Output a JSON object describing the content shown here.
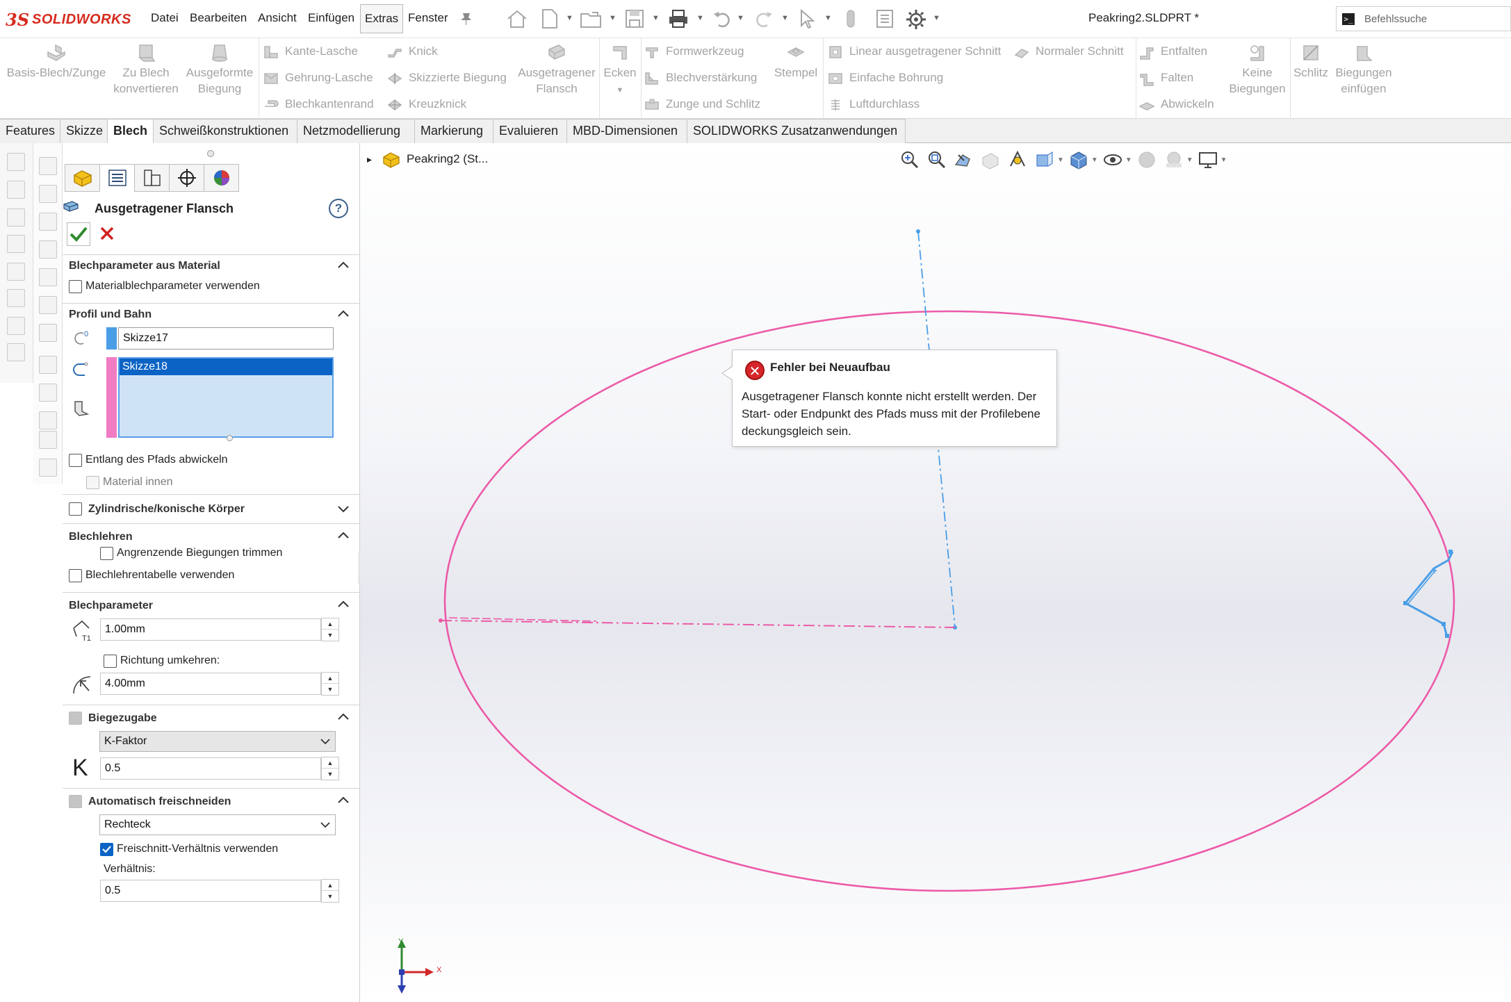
{
  "app": {
    "logo_ds": "3S",
    "logo_text": "SOLIDWORKS",
    "document_title": "Peakring2.SLDPRT *",
    "brand_color": "#d52b1e"
  },
  "menu": {
    "items": [
      "Datei",
      "Bearbeiten",
      "Ansicht",
      "Einfügen",
      "Extras",
      "Fenster"
    ],
    "active": "Extras"
  },
  "search": {
    "placeholder": "Befehlssuche",
    "icon": "terminal-icon"
  },
  "ribbon": {
    "basis_blech": "Basis-Blech/Zunge",
    "zu_blech_1": "Zu Blech",
    "zu_blech_2": "konvertieren",
    "ausgeformte_1": "Ausgeformte",
    "ausgeformte_2": "Biegung",
    "kante_lasche": "Kante-Lasche",
    "gehrung_lasche": "Gehrung-Lasche",
    "blechkantenrand": "Blechkantenrand",
    "knick": "Knick",
    "skizzierte_biegung": "Skizzierte Biegung",
    "kreuzknick": "Kreuzknick",
    "ausgetragener_1": "Ausgetragener",
    "ausgetragener_2": "Flansch",
    "ecken": "Ecken",
    "formwerkzeug": "Formwerkzeug",
    "blechverstaerkung": "Blechverstärkung",
    "zunge_schlitz": "Zunge und Schlitz",
    "stempel": "Stempel",
    "linear_schnitt": "Linear ausgetragener Schnitt",
    "normaler_schnitt": "Normaler Schnitt",
    "einfache_bohrung": "Einfache Bohrung",
    "luftdurchlass": "Luftdurchlass",
    "entfalten": "Entfalten",
    "falten": "Falten",
    "abwickeln": "Abwickeln",
    "keine_1": "Keine",
    "keine_2": "Biegungen",
    "schlitz": "Schlitz",
    "biegungen_1": "Biegungen",
    "biegungen_2": "einfügen"
  },
  "tabs": [
    "Features",
    "Skizze",
    "Blech",
    "Schweißkonstruktionen",
    "Netzmodellierung",
    "Markierung",
    "Evaluieren",
    "MBD-Dimensionen",
    "SOLIDWORKS Zusatzanwendungen"
  ],
  "active_tab": "Blech",
  "pm": {
    "title": "Ausgetragener Flansch",
    "help": "?",
    "sections": {
      "material": {
        "title": "Blechparameter aus Material",
        "cb_label": "Materialblechparameter verwenden",
        "checked": false
      },
      "profil": {
        "title": "Profil und Bahn",
        "profile_value": "Skizze17",
        "path_value": "Skizze18",
        "profile_color": "#4a9ee6",
        "path_color": "#f17cc4",
        "cb_abwickeln": "Entlang des Pfads abwickeln",
        "cb_material_innen": "Material innen"
      },
      "zylinder": {
        "title": "Zylindrische/konische Körper"
      },
      "blechlehren": {
        "title": "Blechlehren",
        "cb_trim": "Angrenzende Biegungen trimmen",
        "cb_tabelle": "Blechlehrentabelle verwenden"
      },
      "blechparameter": {
        "title": "Blechparameter",
        "thickness": "1.00mm",
        "cb_richtung": "Richtung umkehren:",
        "radius": "4.00mm"
      },
      "biegezugabe": {
        "title": "Biegezugabe",
        "type": "K-Faktor",
        "k_label": "K",
        "k_value": "0.5"
      },
      "freischneiden": {
        "title": "Automatisch freischneiden",
        "type": "Rechteck",
        "cb_ratio": "Freischnitt-Verhältnis verwenden",
        "ratio_checked": true,
        "ratio_label": "Verhältnis:",
        "ratio_value": "0.5"
      }
    }
  },
  "tree": {
    "item": "Peakring2 (St...",
    "expand": "▸"
  },
  "error": {
    "title": "Fehler bei Neuaufbau",
    "body": "Ausgetragener Flansch konnte nicht erstellt werden. Der Start- oder Endpunkt des Pfads muss mit der Profilebene deckungsgleich sein."
  },
  "triad": {
    "x": "X",
    "y": "Y"
  },
  "colors": {
    "sketch_path": "#ec5aa8",
    "sketch_profile": "#4a9ee6",
    "selection_blue": "#0b63c5",
    "error_red": "#d7262a"
  }
}
